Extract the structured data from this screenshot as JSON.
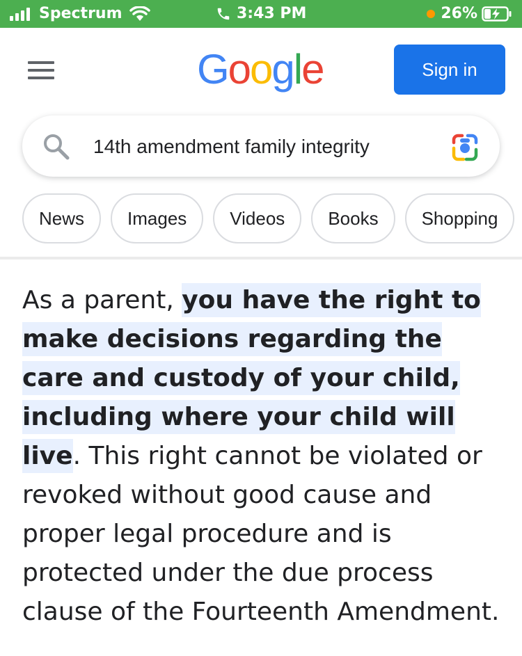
{
  "status_bar": {
    "carrier": "Spectrum",
    "time": "3:43 PM",
    "battery": "26%",
    "icons": [
      "signal-icon",
      "wifi-icon",
      "phone-icon",
      "battery-charging-icon"
    ]
  },
  "header": {
    "logo_letters": [
      {
        "char": "G",
        "color": "#4285F4"
      },
      {
        "char": "o",
        "color": "#EA4335"
      },
      {
        "char": "o",
        "color": "#FBBC05"
      },
      {
        "char": "g",
        "color": "#4285F4"
      },
      {
        "char": "l",
        "color": "#34A853"
      },
      {
        "char": "e",
        "color": "#EA4335"
      }
    ],
    "sign_in_label": "Sign in",
    "accent_color": "#1a73e8"
  },
  "search": {
    "query": "14th amendment family integrity"
  },
  "chips": [
    "News",
    "Images",
    "Videos",
    "Books",
    "Shopping"
  ],
  "snippet": {
    "before": "As a parent, ",
    "highlight": "you have the right to make decisions regarding the care and custody of your child, including where your child will live",
    "after": ". This right cannot be violated or revoked without good cause and proper legal procedure and is protected under the due process clause of the Fourteenth Amendment."
  }
}
